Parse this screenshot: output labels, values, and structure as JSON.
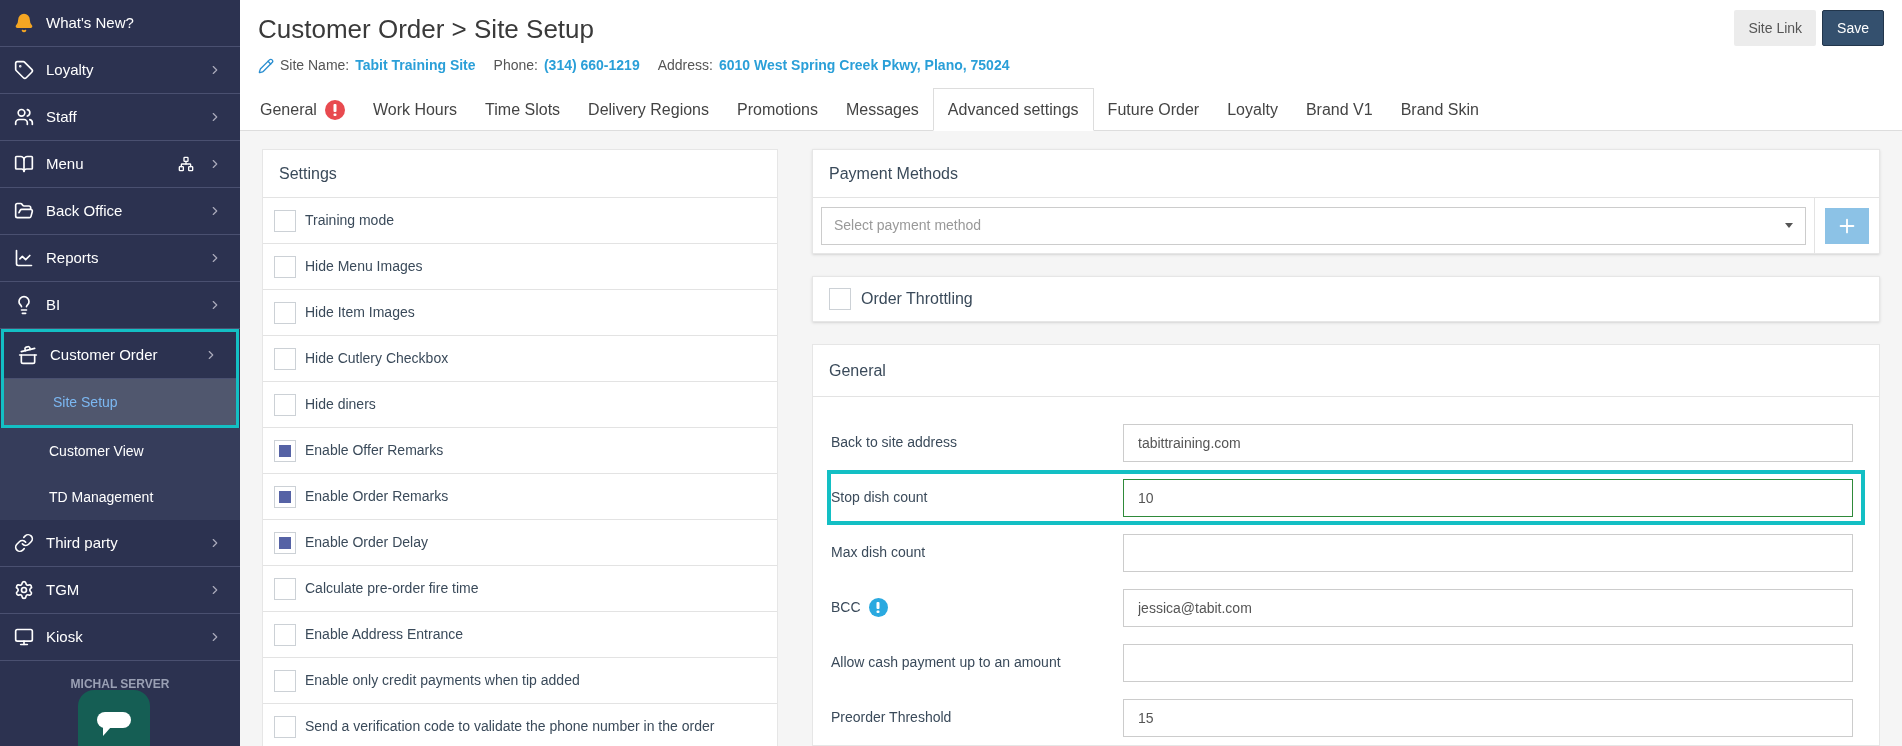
{
  "sidebar": {
    "items": [
      {
        "label": "What's New?"
      },
      {
        "label": "Loyalty"
      },
      {
        "label": "Staff"
      },
      {
        "label": "Menu"
      },
      {
        "label": "Back Office"
      },
      {
        "label": "Reports"
      },
      {
        "label": "BI"
      },
      {
        "label": "Customer Order",
        "highlighted": true,
        "children": [
          {
            "label": "Site Setup",
            "selected": true,
            "highlighted": true
          },
          {
            "label": "Customer View",
            "selected": false,
            "highlighted": false
          },
          {
            "label": "TD Management",
            "selected": false,
            "highlighted": false
          }
        ]
      },
      {
        "label": "Third party"
      },
      {
        "label": "TGM"
      },
      {
        "label": "Kiosk"
      }
    ],
    "footer": "MICHAL SERVER"
  },
  "header": {
    "title": "Customer Order > Site Setup",
    "info": [
      {
        "label": "Site Name:",
        "value": "Tabit Training Site"
      },
      {
        "label": "Phone:",
        "value": "(314) 660-1219"
      },
      {
        "label": "Address:",
        "value": "6010 West Spring Creek Pkwy, Plano, 75024"
      }
    ],
    "buttons": [
      {
        "label": "Site Link",
        "kind": "secondary"
      },
      {
        "label": "Save",
        "kind": "primary"
      }
    ]
  },
  "tabs": [
    {
      "label": "General",
      "selected": false,
      "alert": true
    },
    {
      "label": "Work Hours",
      "selected": false
    },
    {
      "label": "Time Slots",
      "selected": false
    },
    {
      "label": "Delivery Regions",
      "selected": false
    },
    {
      "label": "Promotions",
      "selected": false
    },
    {
      "label": "Messages",
      "selected": false
    },
    {
      "label": "Advanced settings",
      "selected": true
    },
    {
      "label": "Future Order",
      "selected": false
    },
    {
      "label": "Loyalty",
      "selected": false
    },
    {
      "label": "Brand V1",
      "selected": false
    },
    {
      "label": "Brand Skin",
      "selected": false
    }
  ],
  "settings": {
    "title": "Settings",
    "items": [
      {
        "label": "Training mode",
        "checked": false
      },
      {
        "label": "Hide Menu Images",
        "checked": false
      },
      {
        "label": "Hide Item Images",
        "checked": false
      },
      {
        "label": "Hide Cutlery Checkbox",
        "checked": false
      },
      {
        "label": "Hide diners",
        "checked": false
      },
      {
        "label": "Enable Offer Remarks",
        "checked": true
      },
      {
        "label": "Enable Order Remarks",
        "checked": true
      },
      {
        "label": "Enable Order Delay",
        "checked": true
      },
      {
        "label": "Calculate pre-order fire time",
        "checked": false
      },
      {
        "label": "Enable Address Entrance",
        "checked": false
      },
      {
        "label": "Enable only credit payments when tip added",
        "checked": false
      },
      {
        "label": "Send a verification code to validate the phone number in the order",
        "checked": false
      }
    ]
  },
  "payment_methods": {
    "title": "Payment Methods",
    "placeholder": "Select payment method"
  },
  "order_throttling": {
    "label": "Order Throttling",
    "checked": false
  },
  "general": {
    "title": "General",
    "fields": [
      {
        "label": "Back to site address",
        "value": "tabittraining.com",
        "focused": false
      },
      {
        "label": "Stop dish count",
        "value": "10",
        "focused": true,
        "highlighted": true
      },
      {
        "label": "Max dish count",
        "focused": false
      },
      {
        "label": "BCC",
        "value": "jessica@tabit.com",
        "info": true,
        "focused": false
      },
      {
        "label": "Allow cash payment up to an amount",
        "focused": false
      },
      {
        "label": "Preorder Threshold",
        "value": "15",
        "focused": false
      }
    ]
  }
}
